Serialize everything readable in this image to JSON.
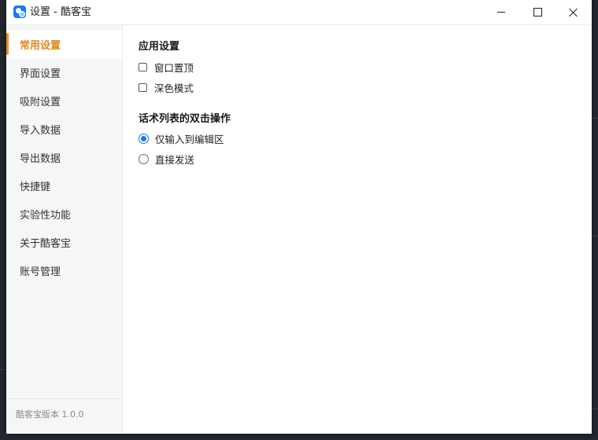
{
  "window": {
    "title": "设置 - 酷客宝"
  },
  "sidebar": {
    "items": [
      {
        "label": "常用设置",
        "active": true
      },
      {
        "label": "界面设置",
        "active": false
      },
      {
        "label": "吸附设置",
        "active": false
      },
      {
        "label": "导入数据",
        "active": false
      },
      {
        "label": "导出数据",
        "active": false
      },
      {
        "label": "快捷键",
        "active": false
      },
      {
        "label": "实验性功能",
        "active": false
      },
      {
        "label": "关于酷客宝",
        "active": false
      },
      {
        "label": "账号管理",
        "active": false
      }
    ],
    "version": "酷客宝版本 1.0.0"
  },
  "main": {
    "app_settings": {
      "title": "应用设置",
      "options": [
        {
          "label": "窗口置顶",
          "checked": false
        },
        {
          "label": "深色模式",
          "checked": false
        }
      ]
    },
    "double_click": {
      "title": "话术列表的双击操作",
      "options": [
        {
          "label": "仅输入到编辑区",
          "selected": true
        },
        {
          "label": "直接发送",
          "selected": false
        }
      ]
    }
  },
  "colors": {
    "accent_active": "#e08a1c",
    "radio_selected": "#1677ff",
    "sidebar_bg": "#f5f6f8"
  }
}
